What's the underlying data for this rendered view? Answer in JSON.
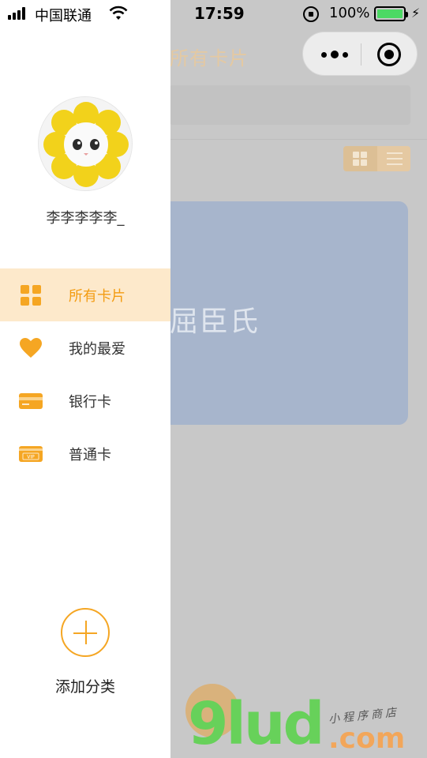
{
  "status_bar": {
    "carrier": "中国联通",
    "time": "17:59",
    "battery_percent": "100%",
    "battery_level": 1.0,
    "icons": [
      "signal-icon",
      "wifi-icon",
      "rotation-lock-icon",
      "battery-icon",
      "charging-icon"
    ]
  },
  "background_page": {
    "title": "所有卡片",
    "card_text": "屈臣氏",
    "menu_capsule_icons": [
      "more-icon",
      "close-target-icon"
    ],
    "view_toggle_icons": [
      "grid-view-icon",
      "list-view-icon"
    ]
  },
  "drawer": {
    "user_name": "李李李李李_",
    "menu": [
      {
        "label": "所有卡片",
        "icon": "grid-icon",
        "active": true
      },
      {
        "label": "我的最爱",
        "icon": "heart-icon",
        "active": false
      },
      {
        "label": "银行卡",
        "icon": "bank-card-icon",
        "active": false
      },
      {
        "label": "普通卡",
        "icon": "vip-card-icon",
        "active": false
      }
    ],
    "add_category_label": "添加分类"
  },
  "watermark": {
    "brand": "9lud",
    "suffix": ".com",
    "tagline": "小程序商店"
  },
  "colors": {
    "accent": "#f5a623",
    "active_bg": "#fde9cb",
    "overlay": "#c8c8c8",
    "card": "#a7b5cc"
  }
}
